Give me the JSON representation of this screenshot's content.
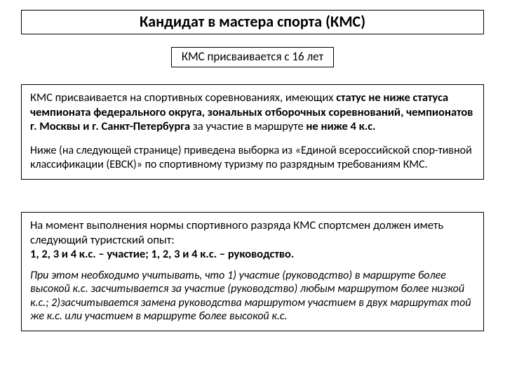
{
  "title": "Кандидат в мастера спорта (КМС)",
  "subtitle": "КМС присваивается с 16 лет",
  "block1": {
    "p1_a": "КМС присваивается на спортивных соревнованиях, имеющих ",
    "p1_b": "статус не ниже статуса чемпионата федерального округа, зональных отборочных соревнований, чемпионатов г. Москвы и г. Санкт-Петербурга",
    "p1_c": " за участие в маршруте ",
    "p1_d": "не ниже 4 к.с.",
    "p2": "Ниже (на следующей странице)  приведена выборка из «Единой всероссийской  спор-тивной классификации (ЕВСК)» по спортивному туризму по разрядным требованиям КМС."
  },
  "block2": {
    "p1": "На момент выполнения нормы спортивного разряда КМС спортсмен должен иметь следующий туристский опыт:",
    "p2": "1, 2, 3 и 4 к.с. – участие;  1, 2, 3 и 4 к.с. – руководство.",
    "p3": "При этом необходимо учитывать, что 1) участие (руководство) в маршруте более высокой к.с. засчитывается за участие (руководство) любым маршрутом более низкой к.с.;   2)засчитывается замена руководства маршрутом участием в двух маршрутах той же к.с. или участием в маршруте более высокой к.с."
  }
}
